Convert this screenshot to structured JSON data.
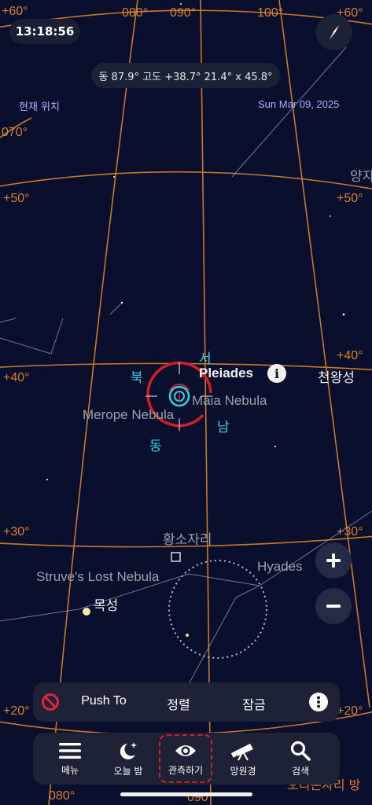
{
  "status": {
    "time": "13:18:56"
  },
  "header": {
    "coords": "동 87.9° 고도 +38.7°   21.4° x 45.8°",
    "location": "현재 위치",
    "date": "Sun Mar 09, 2025"
  },
  "grid_labels": {
    "ra_080_top": "080°",
    "ra_090_top": "090°",
    "ra_100_top": "100°",
    "ra_070": "070°",
    "dec_60_left": "+60°",
    "dec_60_right": "+60°",
    "dec_50_left": "+50°",
    "dec_50_right": "+50°",
    "dec_40_left": "+40°",
    "dec_40_right": "+40°",
    "dec_30_left": "+30°",
    "dec_30_right": "+30°",
    "dec_20_left": "+20°",
    "dec_20_right": "+20°",
    "ra_080_bottom": "080°",
    "ra_090_bottom": "090°"
  },
  "sky_objects": {
    "pleiades": "Pleiades",
    "maia": "Maia Nebula",
    "merope": "Merope Nebula",
    "uranus": "천왕성",
    "taurus": "황소자리",
    "hyades": "Hyades",
    "struve": "Struve's Lost Nebula",
    "jupiter": "목성",
    "aries_partial": "양자",
    "orion_partial": "오리온자리 방"
  },
  "directions": {
    "north": "북",
    "south": "남",
    "east": "동",
    "west": "서"
  },
  "push_bar": {
    "push_to": "Push To",
    "align": "정렬",
    "lock": "잠금"
  },
  "tabs": [
    {
      "label": "메뉴",
      "icon": "menu-icon"
    },
    {
      "label": "오늘 밤",
      "icon": "moon-stars-icon"
    },
    {
      "label": "관측하기",
      "icon": "eye-icon"
    },
    {
      "label": "망원경",
      "icon": "telescope-icon"
    },
    {
      "label": "검색",
      "icon": "search-icon"
    }
  ],
  "colors": {
    "background": "#0a0f2e",
    "grid": "#d4822e",
    "reticle": "#d11f2a",
    "target": "#2fd3e6",
    "selected_tab_border": "#d11f2a"
  }
}
